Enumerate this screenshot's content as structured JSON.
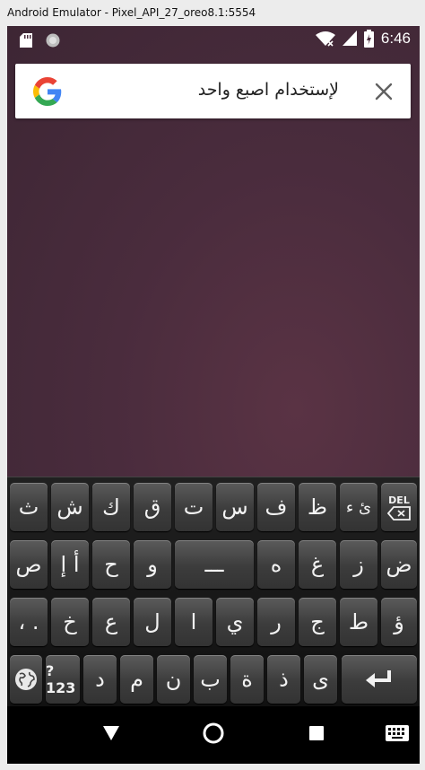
{
  "window": {
    "title": "Android Emulator - Pixel_API_27_oreo8.1:5554"
  },
  "status_bar": {
    "time": "6:46",
    "left_icons": [
      "sd-card-icon",
      "circle-icon"
    ],
    "right_icons": [
      "wifi-icon",
      "signal-icon",
      "battery-icon"
    ]
  },
  "search": {
    "query": "لإستخدام اصبع واحد"
  },
  "keyboard": {
    "row1": [
      "ث",
      "ش",
      "ك",
      "ق",
      "ت",
      "س",
      "ف",
      "ظ",
      "ئ ء",
      "DEL"
    ],
    "row2": [
      "ص",
      "أ إ",
      "ح",
      "و",
      "ـــ",
      "ه",
      "غ",
      "ز",
      "ض"
    ],
    "row3": [
      "، .",
      "خ",
      "ع",
      "ل",
      "ا",
      "ي",
      "ر",
      "ج",
      "ط",
      "ؤ"
    ],
    "row4": [
      "?123",
      "د",
      "م",
      "ن",
      "ب",
      "ة",
      "ذ",
      "ى"
    ]
  },
  "colors": {
    "wallpaper": "#4a2c3d",
    "key": "#4a4a4a"
  }
}
